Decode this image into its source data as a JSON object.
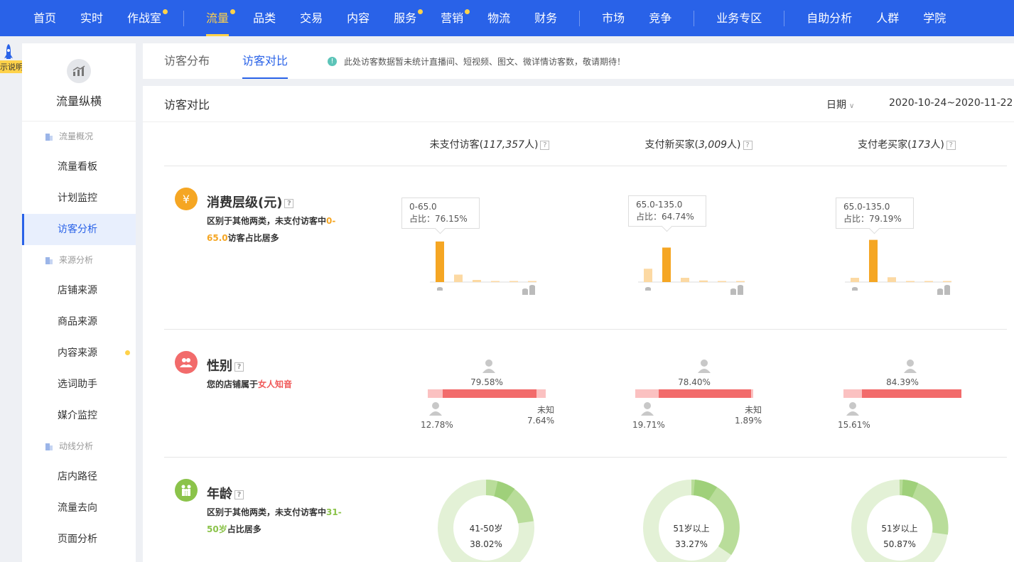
{
  "topnav": {
    "items": [
      "首页",
      "实时",
      "作战室",
      "流量",
      "品类",
      "交易",
      "内容",
      "服务",
      "营销",
      "物流",
      "财务",
      "市场",
      "竞争",
      "业务专区",
      "自助分析",
      "人群",
      "学院"
    ],
    "active": "流量"
  },
  "leftstrip": {
    "tag": "示说明"
  },
  "sidebar": {
    "brand_title": "流量纵横",
    "groups": [
      {
        "label": "流量概况",
        "links": [
          "流量看板",
          "计划监控",
          "访客分析"
        ]
      },
      {
        "label": "来源分析",
        "links": [
          "店铺来源",
          "商品来源",
          "内容来源",
          "选词助手",
          "媒介监控"
        ]
      },
      {
        "label": "动线分析",
        "links": [
          "店内路径",
          "流量去向",
          "页面分析"
        ]
      }
    ],
    "active_link": "访客分析"
  },
  "tabs": {
    "items": [
      "访客分布",
      "访客对比"
    ],
    "active": "访客对比",
    "notice": "此处访客数据暂未统计直播间、短视频、图文、微详情访客数，敬请期待！"
  },
  "main": {
    "title": "访客对比",
    "date_label": "日期",
    "date_range": "2020-10-24~2020-11-22",
    "columns": [
      {
        "label": "未支付访客(",
        "count": "117,357",
        "suffix": "人)"
      },
      {
        "label": "支付新买家(",
        "count": "3,009",
        "suffix": "人)"
      },
      {
        "label": "支付老买家(",
        "count": "173",
        "suffix": "人)"
      }
    ]
  },
  "sections": {
    "consumption": {
      "title": "消费层级(元)",
      "desc_pre": "区别于其他两类，未支付访客中",
      "desc_hl": "0-65.0",
      "desc_post": "访客占比居多",
      "tooltips": [
        {
          "range": "0-65.0",
          "ratio": "占比：76.15%"
        },
        {
          "range": "65.0-135.0",
          "ratio": "占比：64.74%"
        },
        {
          "range": "65.0-135.0",
          "ratio": "占比：79.19%"
        }
      ]
    },
    "gender": {
      "title": "性别",
      "desc_pre": "您的店铺属于",
      "desc_hl": "女人知音",
      "columns": [
        {
          "female": "79.58%",
          "male": "12.78%",
          "unknown_label": "未知",
          "unknown": "7.64%"
        },
        {
          "female": "78.40%",
          "male": "19.71%",
          "unknown_label": "未知",
          "unknown": "1.89%"
        },
        {
          "female": "84.39%",
          "male": "15.61%"
        }
      ]
    },
    "age": {
      "title": "年龄",
      "desc_pre": "区别于其他两类，未支付访客中",
      "desc_hl": "31-50岁",
      "desc_post": "占比居多",
      "donuts": [
        {
          "label": "41-50岁",
          "value": "38.02%"
        },
        {
          "label": "51岁以上",
          "value": "33.27%"
        },
        {
          "label": "51岁以上",
          "value": "50.87%"
        }
      ]
    }
  },
  "chart_data": [
    {
      "type": "bar",
      "title": "未支付访客 消费层级",
      "values": [
        76.15,
        14,
        4,
        2,
        2,
        1.5
      ]
    },
    {
      "type": "bar",
      "title": "支付新买家 消费层级",
      "values": [
        25,
        64.74,
        8,
        3,
        2,
        1.5
      ]
    },
    {
      "type": "bar",
      "title": "支付老买家 消费层级",
      "values": [
        8,
        79.19,
        9,
        1.5,
        1.5,
        1
      ]
    }
  ],
  "colors": {
    "nav_blue": "#2962e8",
    "accent_yellow": "#ffd24a",
    "bar_orange": "#f5a623",
    "bar_light": "#fcd9a3",
    "gender_red": "#f26b6b",
    "gender_pink": "#fbc1c1",
    "age_green": "#9fd07a"
  }
}
